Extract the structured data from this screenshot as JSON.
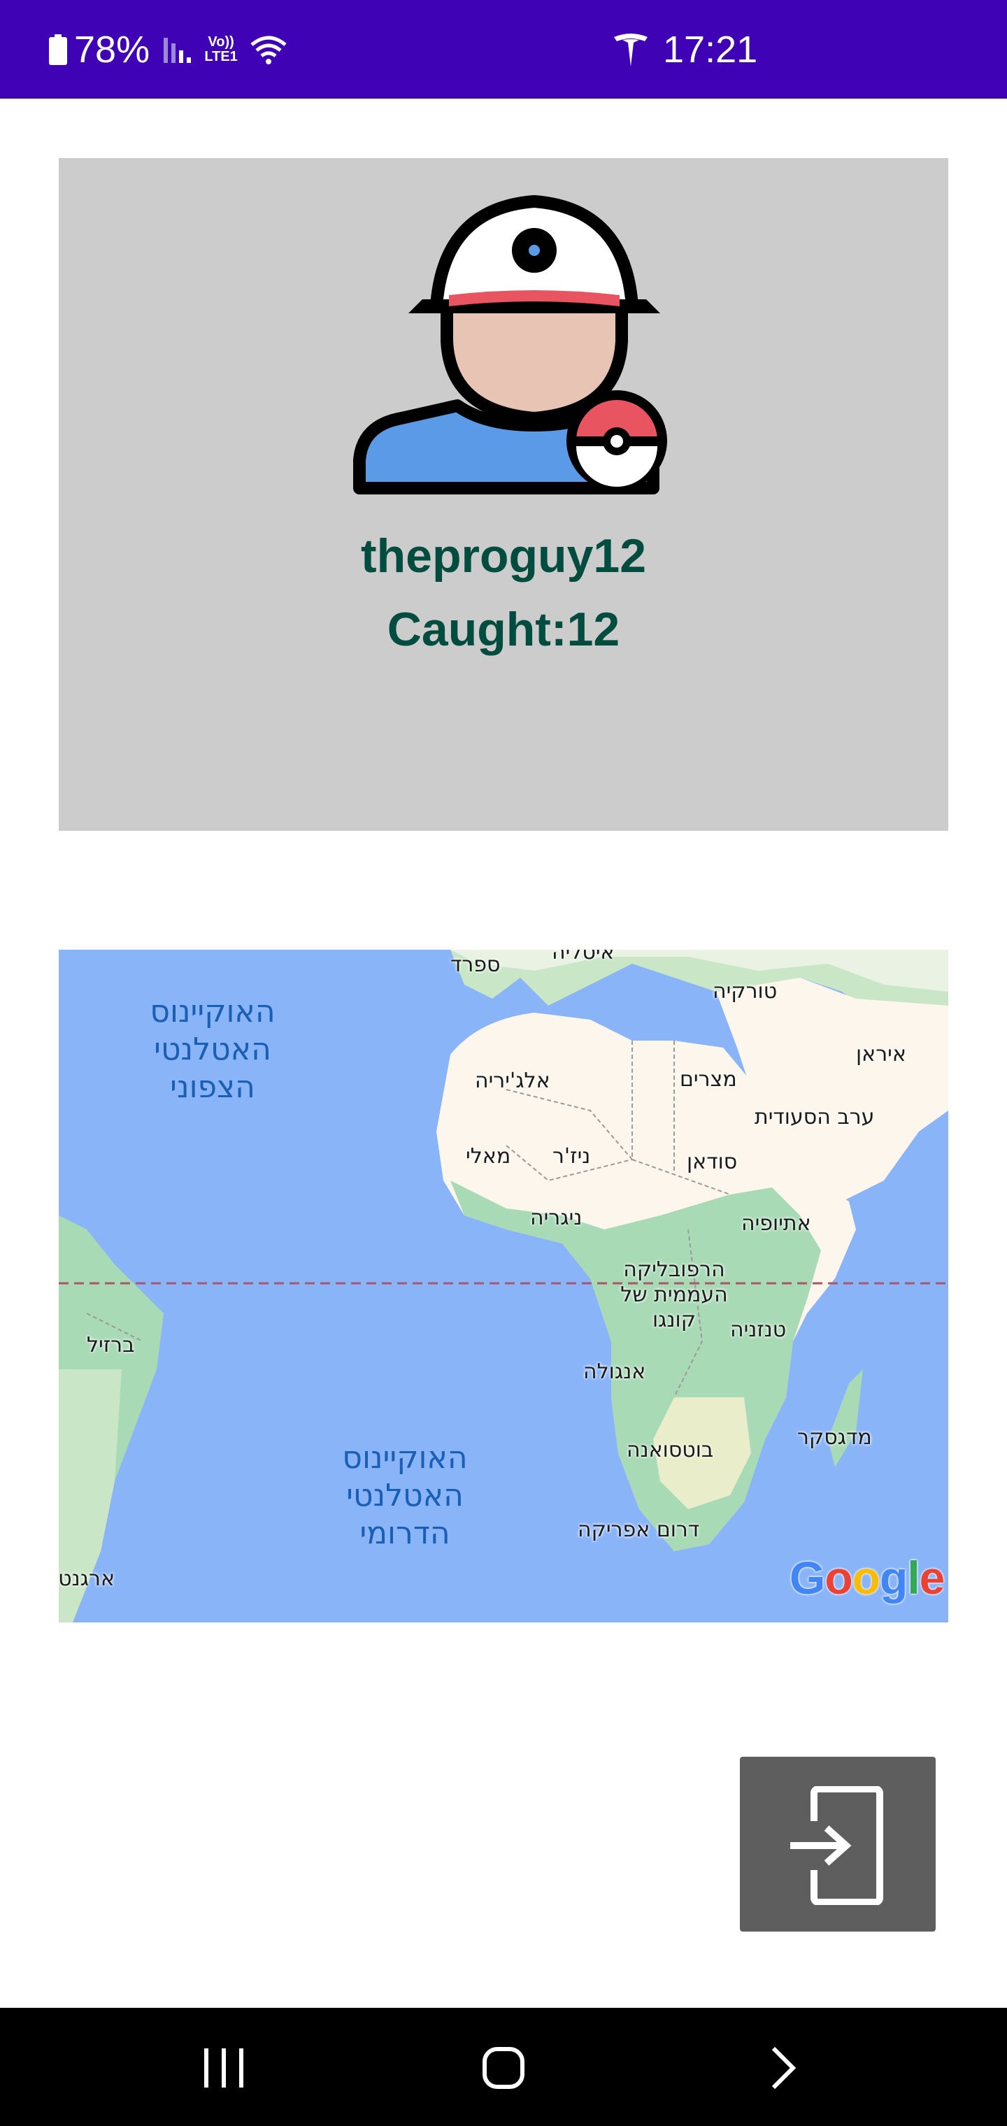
{
  "status_bar": {
    "battery": "78%",
    "network": "Vo)) LTE1",
    "time": "17:21",
    "icons": [
      "battery-icon",
      "signal-icon",
      "wifi-icon",
      "tesla-icon"
    ]
  },
  "profile": {
    "username": "theproguy12",
    "caught": "Caught:12",
    "avatar": "trainer-avatar-icon"
  },
  "map": {
    "labels": {
      "north_atlantic": "האוקיינוס האטלנטי הצפוני",
      "south_atlantic": "האוקיינוס האטלנטי הדרומי",
      "spain": "ספרד",
      "italy": "איטליה",
      "turkey": "טורקיה",
      "iran": "איראן",
      "algeria": "אלג'יריה",
      "egypt": "מצרים",
      "saudi": "ערב הסעודית",
      "mali": "מאלי",
      "niger": "ניז'ר",
      "sudan": "סודאן",
      "nigeria": "ניגריה",
      "ethiopia": "אתיופיה",
      "drc": "הרפובליקה העממית של קונגו",
      "tanzania": "טנזניה",
      "brazil": "ברזיל",
      "angola": "אנגולה",
      "madagascar": "מדגסקר",
      "botswana": "בוטסואנה",
      "south_africa": "דרום אפריקה",
      "argentina": "ארגנטינה"
    },
    "attribution": "Google",
    "colors": {
      "water": "#8ab4f8",
      "land": "#fdf6ec",
      "vegetation": "#a8dab5",
      "equator": "#b0546a"
    }
  },
  "actions": {
    "logout_icon": "logout-icon"
  },
  "nav_bar": {
    "buttons": [
      "recent-apps-icon",
      "home-icon",
      "back-icon"
    ]
  },
  "colors": {
    "status_bar": "#3f02b4",
    "card_bg": "#cccccc",
    "text_accent": "#004d40",
    "button_bg": "#5e5e5e"
  }
}
